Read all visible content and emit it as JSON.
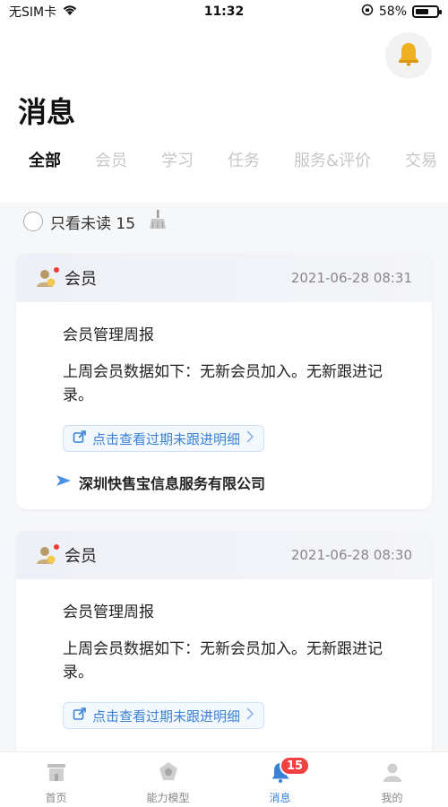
{
  "status_bar": {
    "carrier": "无SIM卡",
    "time": "11:32",
    "battery": "58%",
    "battery_level": 0.58
  },
  "header": {
    "title": "消息",
    "bell_icon": "bell-icon",
    "tabs": [
      {
        "label": "全部",
        "active": true
      },
      {
        "label": "会员",
        "active": false
      },
      {
        "label": "学习",
        "active": false
      },
      {
        "label": "任务",
        "active": false
      },
      {
        "label": "服务&评价",
        "active": false
      },
      {
        "label": "交易",
        "active": false
      }
    ]
  },
  "filter": {
    "label": "只看未读 15",
    "icon": "broom-icon"
  },
  "cards": [
    {
      "category": "会员",
      "time": "2021-06-28 08:31",
      "title": "会员管理周报",
      "text": "上周会员数据如下：无新会员加入。无新跟进记录。",
      "link": "点击查看过期未跟进明细",
      "company": "深圳快售宝信息服务有限公司"
    },
    {
      "category": "会员",
      "time": "2021-06-28 08:30",
      "title": "会员管理周报",
      "text": "上周会员数据如下：无新会员加入。无新跟进记录。",
      "link": "点击查看过期未跟进明细"
    }
  ],
  "bottom_nav": [
    {
      "label": "首页",
      "icon": "home-icon",
      "active": false
    },
    {
      "label": "能力模型",
      "icon": "model-icon",
      "active": false
    },
    {
      "label": "消息",
      "icon": "bell-icon",
      "active": true,
      "badge": "15"
    },
    {
      "label": "我的",
      "icon": "user-icon",
      "active": false
    }
  ],
  "colors": {
    "accent": "#3b82d6",
    "badge": "#f04040",
    "bell": "#f0b020"
  }
}
